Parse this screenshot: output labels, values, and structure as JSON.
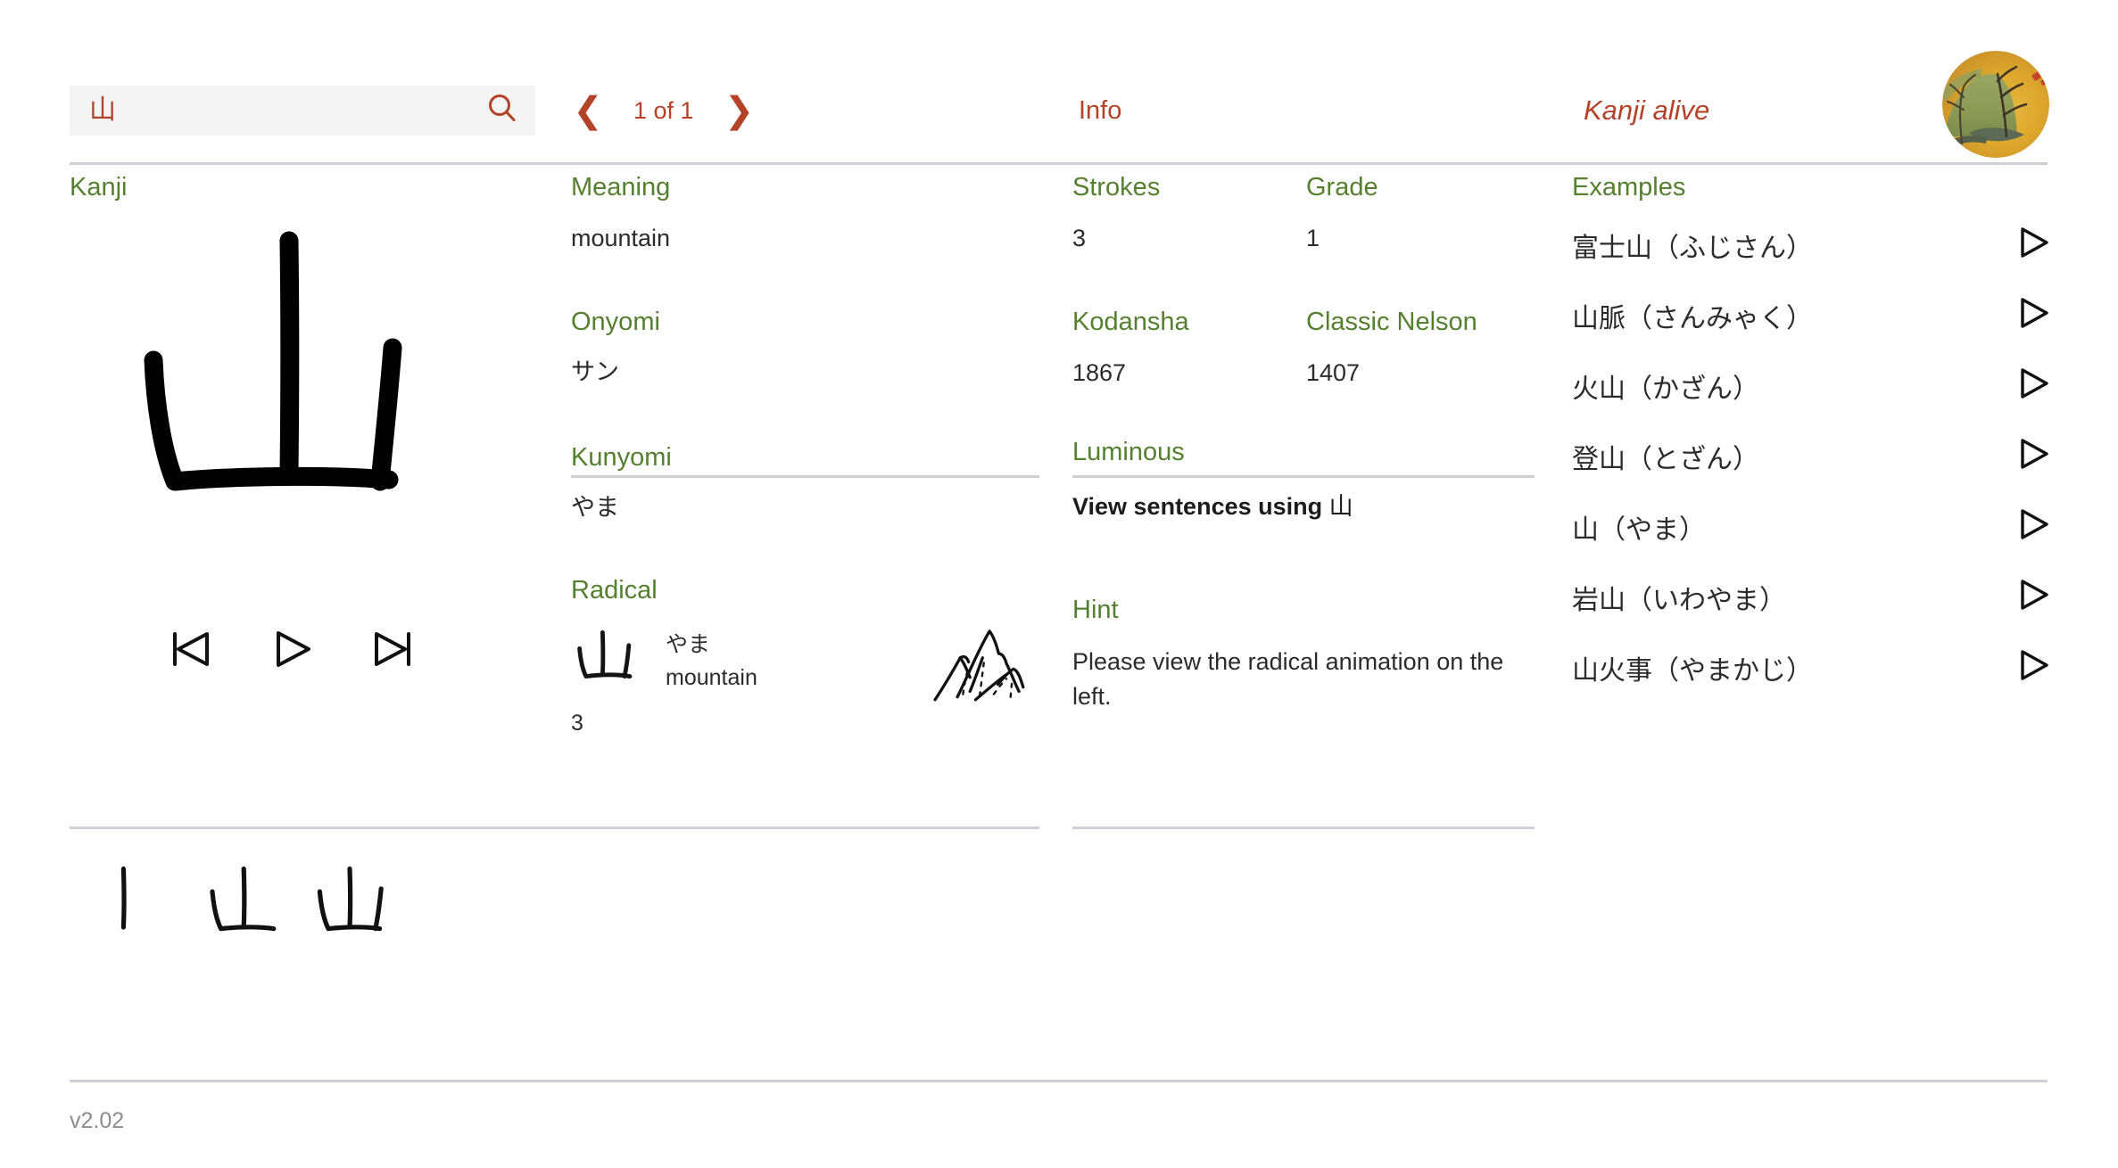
{
  "header": {
    "search": {
      "value": "山",
      "placeholder": "",
      "icon": "search-icon"
    },
    "nav": {
      "prev_icon": "❮",
      "next_icon": "❯",
      "count_label": "1 of 1"
    },
    "info_tab_label": "Info",
    "brand_label": "Kanji alive",
    "avatar_alt": "user-avatar-japanese-screen-painting"
  },
  "colors": {
    "accent_red": "#b34228",
    "label_green": "#54802f",
    "text": "#2b2b2b",
    "rule": "#cfcfd6",
    "search_bg": "#f4f4f4",
    "footer_text": "#8d8d8d"
  },
  "kanji_column": {
    "label": "Kanji",
    "character": "山",
    "controls": [
      {
        "name": "skip-back-button",
        "icon": "skip-back-icon"
      },
      {
        "name": "play-button",
        "icon": "play-icon"
      },
      {
        "name": "skip-forward-button",
        "icon": "skip-forward-icon"
      }
    ],
    "stroke_order_steps": 3
  },
  "meaning_column": {
    "meaning": {
      "label": "Meaning",
      "value": "mountain"
    },
    "onyomi": {
      "label": "Onyomi",
      "value": "サン"
    },
    "kunyomi": {
      "label": "Kunyomi",
      "value": "やま"
    },
    "radical": {
      "label": "Radical",
      "character": "山",
      "stroke_count": "3",
      "reading_jp": "やま",
      "reading_en": "mountain",
      "sketch_alt": "mountain-sketch"
    }
  },
  "info_column": {
    "label": "Info",
    "strokes": {
      "label": "Strokes",
      "value": "3"
    },
    "grade": {
      "label": "Grade",
      "value": "1"
    },
    "kodansha": {
      "label": "Kodansha",
      "value": "1867"
    },
    "classic_nelson": {
      "label": "Classic Nelson",
      "value": "1407"
    },
    "luminous": {
      "label": "Luminous",
      "link_prefix": "View sentences using ",
      "link_kanji": "山"
    },
    "hint": {
      "label": "Hint",
      "text": "Please view the radical animation on the left."
    }
  },
  "examples_column": {
    "label": "Examples",
    "items": [
      {
        "text": "富士山（ふじさん）",
        "play_icon": "play-icon"
      },
      {
        "text": "山脈（さんみゃく）",
        "play_icon": "play-icon"
      },
      {
        "text": "火山（かざん）",
        "play_icon": "play-icon"
      },
      {
        "text": "登山（とざん）",
        "play_icon": "play-icon"
      },
      {
        "text": "山（やま）",
        "play_icon": "play-icon"
      },
      {
        "text": "岩山（いわやま）",
        "play_icon": "play-icon"
      },
      {
        "text": "山火事（やまかじ）",
        "play_icon": "play-icon"
      }
    ]
  },
  "footer": {
    "version": "v2.02"
  }
}
